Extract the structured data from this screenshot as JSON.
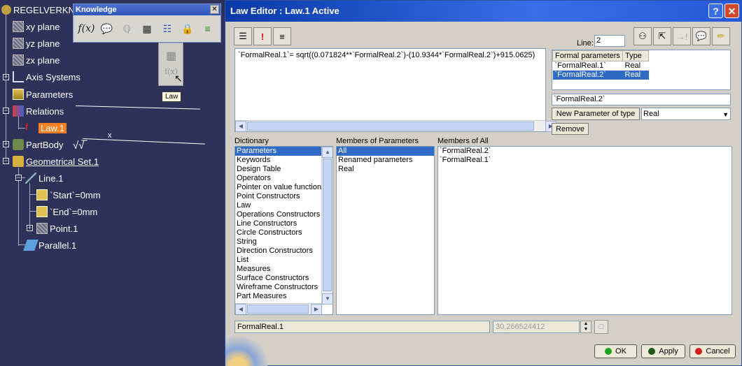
{
  "tree": {
    "root": "REGELVERKN",
    "items": [
      {
        "label": "xy plane"
      },
      {
        "label": "yz plane"
      },
      {
        "label": "zx plane"
      },
      {
        "label": "Axis Systems"
      },
      {
        "label": "Parameters"
      },
      {
        "label": "Relations"
      },
      {
        "label": "Law.1"
      },
      {
        "label": "PartBody"
      },
      {
        "label": "Geometrical Set.1"
      },
      {
        "label": "Line.1"
      },
      {
        "label": "`Start`=0mm"
      },
      {
        "label": "`End`=0mm"
      },
      {
        "label": "Point.1"
      },
      {
        "label": "Parallel.1"
      }
    ],
    "sketch_symbol": "√√̅",
    "sketch_x": "x"
  },
  "knowledge": {
    "title": "Knowledge",
    "close": "✕",
    "icons": [
      "formula-icon",
      "comment-icon",
      "check-icon",
      "table-icon",
      "law-tree-icon",
      "lock-icon",
      "parameter-icon"
    ],
    "tooltip": "Law"
  },
  "dialog": {
    "title": "Law Editor : Law.1 Active",
    "help": "?",
    "close": "✕",
    "line_label": "Line:",
    "line_value": "2",
    "formula": "`FormalReal.1`= sqrt((0.071824**`FormalReal.2`)-(10.9344*`FormalReal.2`)+915.0625)",
    "formal_params": {
      "headers": [
        "Formal parameters",
        "Type"
      ],
      "rows": [
        {
          "name": "`FormalReal.1`",
          "type": "Real"
        },
        {
          "name": "`FormalReal.2`",
          "type": "Real"
        }
      ],
      "selected_name": "`FormalReal.2`",
      "new_param_label": "New Parameter of type",
      "new_param_type": "Real",
      "remove_label": "Remove"
    },
    "dictionary": {
      "header": "Dictionary",
      "items": [
        "Parameters",
        "Keywords",
        "Design Table",
        "Operators",
        "Pointer on value function:",
        "Point Constructors",
        "Law",
        "Operations Constructors",
        "Line Constructors",
        "Circle Constructors",
        "String",
        "Direction Constructors",
        "List",
        "Measures",
        "Surface Constructors",
        "Wireframe Constructors",
        "Part Measures"
      ]
    },
    "members_params": {
      "header": "Members of Parameters",
      "items": [
        "All",
        "Renamed parameters",
        "Real"
      ]
    },
    "members_all": {
      "header": "Members of All",
      "items": [
        "`FormalReal.2`",
        "`FormalReal.1`"
      ]
    },
    "status_field": "FormalReal.1",
    "value_field": "30,266524412",
    "ok": "OK",
    "apply": "Apply",
    "cancel": "Cancel"
  },
  "colors": {
    "tree_bg": "#2e3158",
    "selection": "#316ac5",
    "law_highlight": "#f58020"
  }
}
